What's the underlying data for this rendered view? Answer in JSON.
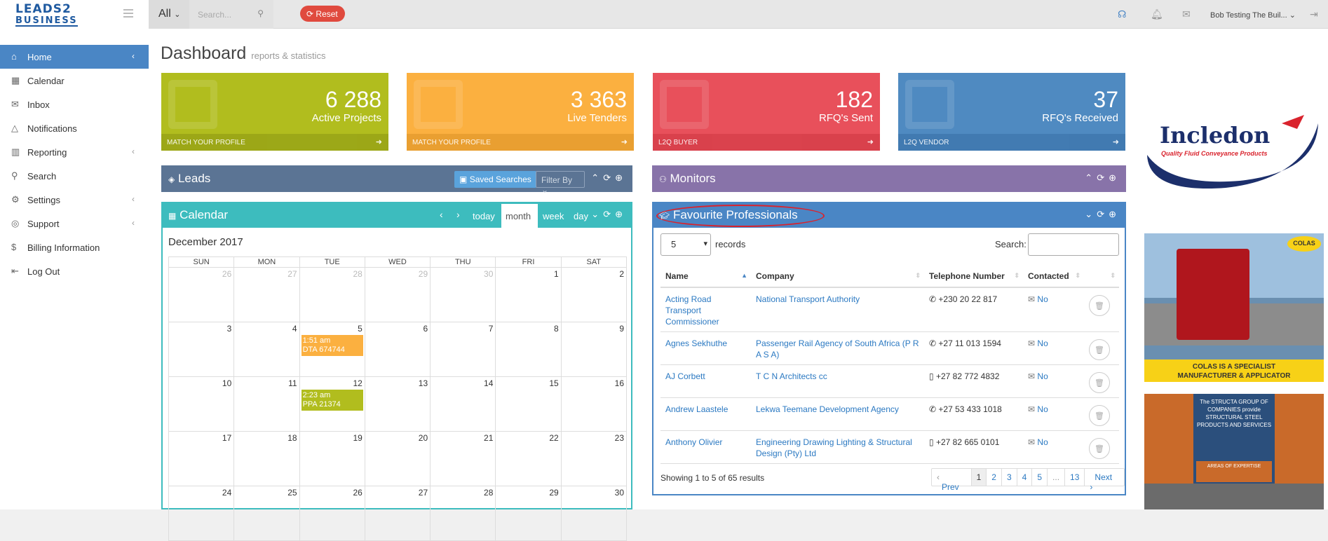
{
  "header": {
    "logo_line1": "LEADS2",
    "logo_line2": "BUSINESS",
    "all_label": "All",
    "search_placeholder": "Search...",
    "reset_label": "Reset",
    "user_name": "Bob Testing The Buil..."
  },
  "sidebar": {
    "items": [
      {
        "label": "Home"
      },
      {
        "label": "Calendar"
      },
      {
        "label": "Inbox"
      },
      {
        "label": "Notifications"
      },
      {
        "label": "Reporting"
      },
      {
        "label": "Search"
      },
      {
        "label": "Settings"
      },
      {
        "label": "Support"
      },
      {
        "label": "Billing Information"
      },
      {
        "label": "Log Out"
      }
    ]
  },
  "page": {
    "title": "Dashboard",
    "subtitle": "reports & statistics"
  },
  "stats": [
    {
      "value": "6 288",
      "label": "Active Projects",
      "footer": "MATCH YOUR PROFILE",
      "color": "#b1bd1e"
    },
    {
      "value": "3 363",
      "label": "Live Tenders",
      "footer": "MATCH YOUR PROFILE",
      "color": "#fbb040"
    },
    {
      "value": "182",
      "label": "RFQ's Sent",
      "footer": "L2Q BUYER",
      "color": "#e8505b"
    },
    {
      "value": "37",
      "label": "RFQ's Received",
      "footer": "L2Q VENDOR",
      "color": "#4f8ac1"
    }
  ],
  "leads": {
    "title": "Leads",
    "saved_searches": "Saved Searches",
    "filter_by": "Filter By"
  },
  "monitors": {
    "title": "Monitors"
  },
  "calendar": {
    "title": "Calendar",
    "today": "today",
    "month": "month",
    "week": "week",
    "day": "day",
    "month_title": "December 2017",
    "weekdays": [
      "SUN",
      "MON",
      "TUE",
      "WED",
      "THU",
      "FRI",
      "SAT"
    ],
    "weeks": [
      [
        "26",
        "27",
        "28",
        "29",
        "30",
        "1",
        "2"
      ],
      [
        "3",
        "4",
        "5",
        "6",
        "7",
        "8",
        "9"
      ],
      [
        "10",
        "11",
        "12",
        "13",
        "14",
        "15",
        "16"
      ],
      [
        "17",
        "18",
        "19",
        "20",
        "21",
        "22",
        "23"
      ],
      [
        "24",
        "25",
        "26",
        "27",
        "28",
        "29",
        "30"
      ]
    ],
    "events": [
      {
        "time": "1:51 am",
        "ref": "DTA 674744"
      },
      {
        "time": "2:23 am",
        "ref": "PPA 21374"
      }
    ]
  },
  "favourites": {
    "title": "Favourite Professionals",
    "page_size": "5",
    "records_label": "records",
    "search_label": "Search:",
    "columns": [
      "Name",
      "Company",
      "Telephone Number",
      "Contacted"
    ],
    "rows": [
      {
        "name": "Acting Road Transport Commissioner",
        "company": "National Transport Authority",
        "phone": "+230 20 22 817",
        "contacted": "No"
      },
      {
        "name": "Agnes Sekhuthe",
        "company": "Passenger Rail Agency of South Africa (P R A S A)",
        "phone": "+27 11 013 1594",
        "contacted": "No"
      },
      {
        "name": "AJ Corbett",
        "company": "T C N Architects cc",
        "phone": "+27 82 772 4832",
        "contacted": "No"
      },
      {
        "name": "Andrew Laastele",
        "company": "Lekwa Teemane Development Agency",
        "phone": "+27 53 433 1018",
        "contacted": "No"
      },
      {
        "name": "Anthony Olivier",
        "company": "Engineering Drawing Lighting & Structural Design (Pty) Ltd",
        "phone": "+27 82 665 0101",
        "contacted": "No"
      }
    ],
    "showing": "Showing 1 to 5 of 65 results",
    "pager": [
      "Prev",
      "1",
      "2",
      "3",
      "4",
      "5",
      "...",
      "13",
      "Next"
    ]
  },
  "ads": {
    "incledon_name": "Incledon",
    "incledon_tag": "Quality Fluid Conveyance Products",
    "colas_badge": "COLAS",
    "colas_text": "COLAS IS A SPECIALIST MANUFACTURER & APPLICATOR",
    "structa_text": "The STRUCTA GROUP OF COMPANIES provide STRUCTURAL STEEL PRODUCTS AND SERVICES",
    "structa_areas": "AREAS OF EXPERTISE"
  }
}
